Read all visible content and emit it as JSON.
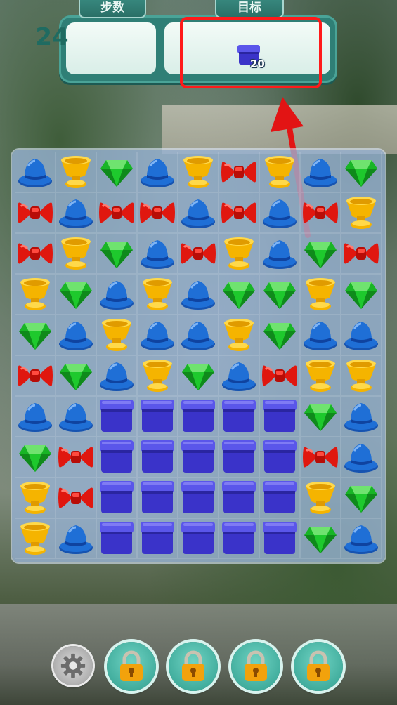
{
  "hud": {
    "steps_label": "步数",
    "steps_value": "24",
    "goal_label": "目标",
    "goal_count": "20",
    "goal_item": "blue-box"
  },
  "annotation": {
    "highlight_color": "#ff1a1a",
    "arrow_color": "#e21414"
  },
  "board": {
    "rows": [
      [
        "hat",
        "cup",
        "gem",
        "hat",
        "cup",
        "bow",
        "cup",
        "hat",
        "gem"
      ],
      [
        "bow",
        "hat",
        "bow",
        "bow",
        "hat",
        "bow",
        "hat",
        "bow",
        "cup"
      ],
      [
        "bow",
        "cup",
        "gem",
        "hat",
        "bow",
        "cup",
        "hat",
        "gem",
        "bow"
      ],
      [
        "cup",
        "gem",
        "hat",
        "cup",
        "hat",
        "gem",
        "gem",
        "cup",
        "gem"
      ],
      [
        "gem",
        "hat",
        "cup",
        "hat",
        "hat",
        "cup",
        "gem",
        "hat",
        "hat"
      ],
      [
        "bow",
        "gem",
        "hat",
        "cup",
        "gem",
        "hat",
        "bow",
        "cup",
        "cup"
      ],
      [
        "hat",
        "hat",
        "box",
        "box",
        "box",
        "box",
        "box",
        "gem",
        "hat"
      ],
      [
        "gem",
        "bow",
        "box",
        "box",
        "box",
        "box",
        "box",
        "bow",
        "hat"
      ],
      [
        "cup",
        "bow",
        "box",
        "box",
        "box",
        "box",
        "box",
        "cup",
        "gem"
      ],
      [
        "cup",
        "hat",
        "box",
        "box",
        "box",
        "box",
        "box",
        "gem",
        "hat"
      ]
    ]
  },
  "toolbar": {
    "buttons": [
      {
        "name": "settings-button",
        "icon": "gear-icon"
      },
      {
        "name": "locked-booster-1",
        "icon": "lock-icon"
      },
      {
        "name": "locked-booster-2",
        "icon": "lock-icon"
      },
      {
        "name": "locked-booster-3",
        "icon": "lock-icon"
      },
      {
        "name": "locked-booster-4",
        "icon": "lock-icon"
      }
    ]
  },
  "colors": {
    "hud_teal": "#2f7f76",
    "hat_blue": "#1f6fd6",
    "cup_gold": "#f5b400",
    "gem_green": "#18b526",
    "bow_red": "#e0170f",
    "box_indigo": "#3a33c9"
  }
}
